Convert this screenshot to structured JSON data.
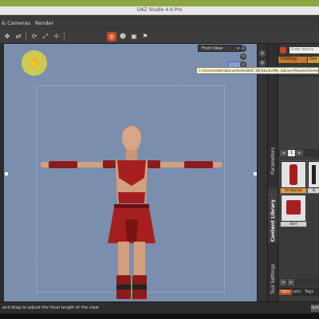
{
  "window": {
    "title": "DAZ Studio 4.6 Pro"
  },
  "menu": {
    "items": [
      "& Cameras",
      "Render"
    ]
  },
  "toolbar": {
    "icons": [
      "universal-tool",
      "translate",
      "rotate",
      "scale",
      "node-select",
      "active-pose",
      "figure-tool",
      "camera-tool",
      "render-tool"
    ]
  },
  "viewport": {
    "view_label": "Front View",
    "path_tooltip": "C:\\Users\\staln\\Documents\\DAZ 3D\\Studio\\My Library\\People\\Genesis 2 Female\\Clothing\\"
  },
  "right_panel": {
    "search_placeholder": "Enter text to filter",
    "crumb": "Clothing",
    "crumb2": "Gen",
    "tabs": {
      "parameters": "Parameters",
      "content_library": "Content Library",
      "tool_settings": "Tool Settings"
    },
    "page": "1",
    "thumbs": [
      "Armbands",
      "B",
      "Skirt"
    ],
    "bottom_tabs": [
      "Opts",
      "sets",
      "Tags"
    ]
  },
  "status": {
    "text": "and drag to adjust the focal length of the view",
    "button": "Selec"
  },
  "colors": {
    "accent": "#c54a1d",
    "viewport": "#7a8fae",
    "title_green": "#8ea640",
    "outfit": "#a61f1f"
  }
}
